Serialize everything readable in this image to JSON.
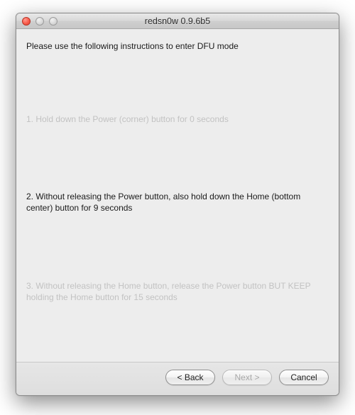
{
  "window": {
    "title": "redsn0w 0.9.6b5"
  },
  "instruction": "Please use the following instructions to enter DFU mode",
  "steps": [
    {
      "active": false,
      "text": "1. Hold down the Power (corner) button for 0 seconds"
    },
    {
      "active": true,
      "text": "2. Without releasing the Power button, also hold down the Home (bottom center) button for 9 seconds"
    },
    {
      "active": false,
      "text": "3. Without releasing the Home button, release the Power button BUT KEEP holding the Home button for 15 seconds"
    }
  ],
  "buttons": {
    "back": "< Back",
    "next": "Next >",
    "cancel": "Cancel"
  }
}
